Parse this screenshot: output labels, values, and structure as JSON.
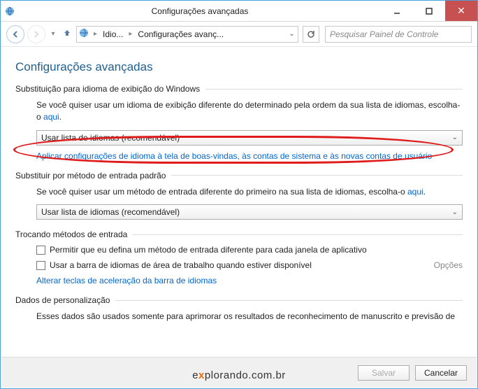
{
  "window": {
    "title": "Configurações avançadas"
  },
  "nav": {
    "crumb1": "Idio...",
    "crumb2": "Configurações avanç...",
    "search_placeholder": "Pesquisar Painel de Controle"
  },
  "page": {
    "title": "Configurações avançadas"
  },
  "sec1": {
    "heading": "Substituição para idioma de exibição do Windows",
    "desc_a": "Se você quiser usar um idioma de exibição diferente do determinado pela ordem da sua lista de idiomas, escolha-o ",
    "desc_link": "aqui",
    "combo": "Usar lista de idiomas (recomendável)",
    "link": "Aplicar configurações de idioma à tela de boas-vindas, às contas de sistema e às novas contas de usuário"
  },
  "sec2": {
    "heading": "Substituir por método de entrada padrão",
    "desc_a": "Se você quiser usar um método de entrada diferente do primeiro na sua lista de idiomas, escolha-o ",
    "desc_link": "aqui",
    "combo": "Usar lista de idiomas (recomendável)"
  },
  "sec3": {
    "heading": "Trocando métodos de entrada",
    "chk1": "Permitir que eu defina um método de entrada diferente para cada janela de aplicativo",
    "chk2": "Usar a barra de idiomas de área de trabalho quando estiver disponível",
    "options": "Opções",
    "link": "Alterar teclas de aceleração da barra de idiomas"
  },
  "sec4": {
    "heading": "Dados de personalização",
    "desc": "Esses dados são usados somente para aprimorar os resultados de reconhecimento de manuscrito e previsão de"
  },
  "footer": {
    "save": "Salvar",
    "cancel": "Cancelar"
  }
}
